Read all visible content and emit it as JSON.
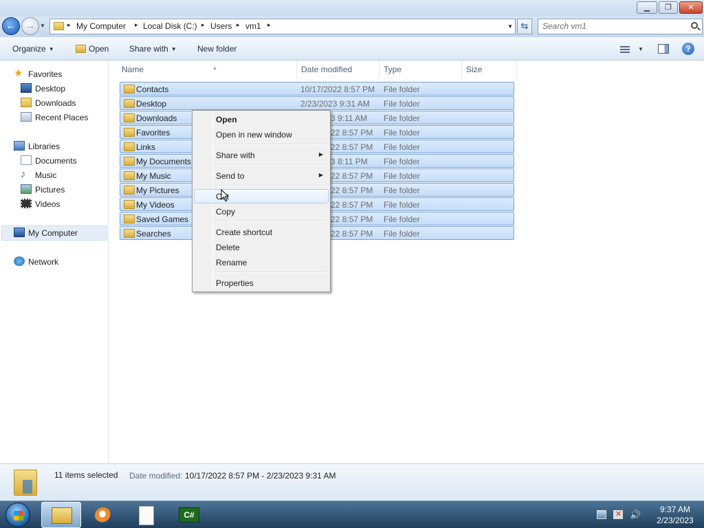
{
  "window": {
    "minimize_glyph": "▁",
    "maximize_glyph": "❐",
    "close_glyph": "✕"
  },
  "nav": {
    "back_glyph": "←",
    "forward_glyph": "→",
    "breadcrumbs": [
      "My Computer",
      "Local Disk (C:)",
      "Users",
      "vm1"
    ],
    "crumb_separator": "▸",
    "refresh_glyph": "⇆",
    "search_placeholder": "Search vm1"
  },
  "toolbar": {
    "organize": "Organize",
    "open": "Open",
    "share_with": "Share with",
    "new_folder": "New folder",
    "dropdown_glyph": "▼",
    "help_glyph": "?"
  },
  "sidebar": {
    "favorites": {
      "label": "Favorites",
      "items": [
        "Desktop",
        "Downloads",
        "Recent Places"
      ]
    },
    "libraries": {
      "label": "Libraries",
      "items": [
        "Documents",
        "Music",
        "Pictures",
        "Videos"
      ]
    },
    "computer": "My Computer",
    "network": "Network"
  },
  "columns": [
    "Name",
    "Date modified",
    "Type",
    "Size"
  ],
  "sort_indicator": "▲",
  "files": [
    {
      "name": "Contacts",
      "date": "10/17/2022 8:57 PM",
      "type": "File folder"
    },
    {
      "name": "Desktop",
      "date": "2/23/2023 9:31 AM",
      "type": "File folder"
    },
    {
      "name": "Downloads",
      "date": "3 9:11 AM",
      "type": "File folder"
    },
    {
      "name": "Favorites",
      "date": "22 8:57 PM",
      "type": "File folder"
    },
    {
      "name": "Links",
      "date": "22 8:57 PM",
      "type": "File folder"
    },
    {
      "name": "My Documents",
      "date": "3 8:11 PM",
      "type": "File folder"
    },
    {
      "name": "My Music",
      "date": "22 8:57 PM",
      "type": "File folder"
    },
    {
      "name": "My Pictures",
      "date": "22 8:57 PM",
      "type": "File folder"
    },
    {
      "name": "My Videos",
      "date": "22 8:57 PM",
      "type": "File folder"
    },
    {
      "name": "Saved Games",
      "date": "22 8:57 PM",
      "type": "File folder"
    },
    {
      "name": "Searches",
      "date": "22 8:57 PM",
      "type": "File folder"
    }
  ],
  "context_menu": {
    "open": "Open",
    "open_new_window": "Open in new window",
    "share_with": "Share with",
    "send_to": "Send to",
    "cut": "Cut",
    "copy": "Copy",
    "create_shortcut": "Create shortcut",
    "delete": "Delete",
    "rename": "Rename",
    "properties": "Properties",
    "submenu_glyph": "▶"
  },
  "details": {
    "count": "11 items selected",
    "date_label": "Date modified:",
    "date_value": "10/17/2022 8:57 PM - 2/23/2023 9:31 AM"
  },
  "taskbar": {
    "csharp_label": "C#",
    "volume_glyph": "🔊",
    "time": "9:37 AM",
    "date": "2/23/2023"
  }
}
